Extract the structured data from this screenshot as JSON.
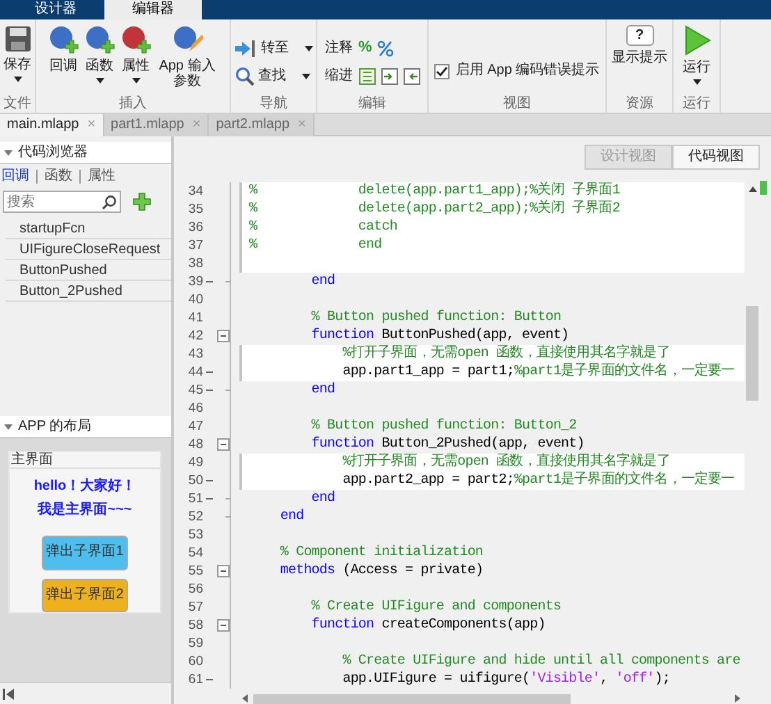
{
  "top_tabs": [
    {
      "label": "设计器",
      "selected": false
    },
    {
      "label": "编辑器",
      "selected": true
    }
  ],
  "ribbon_groups": [
    {
      "label": "文件",
      "items": [
        {
          "kind": "big",
          "label": "保存",
          "dropdown": true
        }
      ]
    },
    {
      "label": "插入",
      "items": [
        {
          "kind": "big",
          "label": "回调",
          "dropdown": false
        },
        {
          "kind": "big",
          "label": "函数",
          "dropdown": true
        },
        {
          "kind": "big",
          "label": "属性",
          "dropdown": true
        },
        {
          "kind": "big",
          "label": "App 输入参数",
          "dropdown": false
        }
      ]
    },
    {
      "label": "导航",
      "items": [
        {
          "kind": "small",
          "label": "转至",
          "dropdown": true
        },
        {
          "kind": "small",
          "label": "查找",
          "dropdown": true
        }
      ]
    },
    {
      "label": "编辑",
      "items": [
        {
          "kind": "tool",
          "label": "注释",
          "symbol": "%"
        },
        {
          "kind": "tool",
          "label": "缩进"
        }
      ]
    },
    {
      "label": "视图",
      "items": [
        {
          "kind": "check",
          "label": "启用 App 编码错误提示",
          "checked": true
        }
      ]
    },
    {
      "label": "资源",
      "items": [
        {
          "kind": "big",
          "label": "显示提示",
          "dropdown": false,
          "symbol": "?"
        }
      ]
    },
    {
      "label": "运行",
      "items": [
        {
          "kind": "big",
          "label": "运行",
          "dropdown": true
        }
      ]
    }
  ],
  "file_tabs": [
    {
      "label": "main.mlapp",
      "close": "×",
      "selected": true
    },
    {
      "label": "part1.mlapp",
      "close": "×",
      "selected": false
    },
    {
      "label": "part2.mlapp",
      "close": "×",
      "selected": false
    }
  ],
  "code_browser": {
    "title": "代码浏览器",
    "expanded": true,
    "tabs": [
      {
        "label": "回调",
        "selected": true
      },
      {
        "label": "函数",
        "selected": false
      },
      {
        "label": "属性",
        "selected": false
      }
    ],
    "search": {
      "placeholder": "搜索"
    },
    "items": [
      "startupFcn",
      "UIFigureCloseRequest",
      "ButtonPushed",
      "Button_2Pushed"
    ]
  },
  "layout_panel": {
    "title": "APP 的布局",
    "expanded": true,
    "window_title": "主界面",
    "labels": [
      "hello！大家好！",
      "我是主界面~~~"
    ],
    "buttons": [
      {
        "label": "弹出子界面1",
        "color": "#4dbeee"
      },
      {
        "label": "弹出子界面2",
        "color": "#edb120"
      }
    ]
  },
  "view_toggle": [
    {
      "label": "设计视图",
      "selected": false
    },
    {
      "label": "代码视图",
      "selected": true
    }
  ],
  "code": {
    "lines": [
      {
        "number": "34",
        "executable": false,
        "fold": false,
        "fold_end": false,
        "editable": true,
        "tokens": [
          {
            "kind": "comment",
            "text": "%             delete(app.part1_app);%关闭 子界面1"
          }
        ]
      },
      {
        "number": "35",
        "executable": false,
        "fold": false,
        "fold_end": false,
        "editable": true,
        "tokens": [
          {
            "kind": "comment",
            "text": "%             delete(app.part2_app);%关闭 子界面2"
          }
        ]
      },
      {
        "number": "36",
        "executable": false,
        "fold": false,
        "fold_end": false,
        "editable": true,
        "tokens": [
          {
            "kind": "comment",
            "text": "%             catch"
          }
        ]
      },
      {
        "number": "37",
        "executable": false,
        "fold": false,
        "fold_end": false,
        "editable": true,
        "tokens": [
          {
            "kind": "comment",
            "text": "%             end"
          }
        ]
      },
      {
        "number": "38",
        "executable": false,
        "fold": false,
        "fold_end": false,
        "editable": true
      },
      {
        "number": "39",
        "executable": true,
        "fold": false,
        "fold_end": true,
        "editable": false,
        "tokens": [
          {
            "kind": "keyword",
            "text": "        end"
          }
        ]
      },
      {
        "number": "40",
        "executable": false,
        "fold": false,
        "fold_end": false,
        "editable": false
      },
      {
        "number": "41",
        "executable": false,
        "fold": false,
        "fold_end": false,
        "editable": false,
        "tokens": [
          {
            "kind": "comment",
            "text": "        % Button pushed function: Button"
          }
        ]
      },
      {
        "number": "42",
        "executable": false,
        "fold": true,
        "fold_end": false,
        "editable": false,
        "tokens": [
          {
            "kind": "keyword",
            "text": "        function"
          },
          {
            "kind": "plain",
            "text": " ButtonPushed(app, event)"
          }
        ]
      },
      {
        "number": "43",
        "executable": false,
        "fold": false,
        "fold_end": false,
        "editable": true,
        "tokens": [
          {
            "kind": "comment",
            "text": "            %打开子界面，无需open 函数，直接使用其名字就是了"
          }
        ]
      },
      {
        "number": "44",
        "executable": true,
        "fold": false,
        "fold_end": false,
        "editable": true,
        "tokens": [
          {
            "kind": "plain",
            "text": "            app.part1_app = part1;"
          },
          {
            "kind": "comment",
            "text": "%part1是子界面的文件名，一定要一"
          }
        ]
      },
      {
        "number": "45",
        "executable": true,
        "fold": false,
        "fold_end": true,
        "editable": false,
        "tokens": [
          {
            "kind": "keyword",
            "text": "        end"
          }
        ]
      },
      {
        "number": "46",
        "executable": false,
        "fold": false,
        "fold_end": false,
        "editable": false
      },
      {
        "number": "47",
        "executable": false,
        "fold": false,
        "fold_end": false,
        "editable": false,
        "tokens": [
          {
            "kind": "comment",
            "text": "        % Button pushed function: Button_2"
          }
        ]
      },
      {
        "number": "48",
        "executable": false,
        "fold": true,
        "fold_end": false,
        "editable": false,
        "tokens": [
          {
            "kind": "keyword",
            "text": "        function"
          },
          {
            "kind": "plain",
            "text": " Button_2Pushed(app, event)"
          }
        ]
      },
      {
        "number": "49",
        "executable": false,
        "fold": false,
        "fold_end": false,
        "editable": true,
        "tokens": [
          {
            "kind": "comment",
            "text": "            %打开子界面，无需open 函数，直接使用其名字就是了"
          }
        ]
      },
      {
        "number": "50",
        "executable": true,
        "fold": false,
        "fold_end": false,
        "editable": true,
        "tokens": [
          {
            "kind": "plain",
            "text": "            app.part2_app = part2;"
          },
          {
            "kind": "comment",
            "text": "%part1是子界面的文件名，一定要一"
          }
        ]
      },
      {
        "number": "51",
        "executable": true,
        "fold": false,
        "fold_end": true,
        "editable": false,
        "tokens": [
          {
            "kind": "keyword",
            "text": "        end"
          }
        ]
      },
      {
        "number": "52",
        "executable": false,
        "fold": false,
        "fold_end": true,
        "editable": false,
        "tokens": [
          {
            "kind": "keyword",
            "text": "    end"
          }
        ]
      },
      {
        "number": "53",
        "executable": false,
        "fold": false,
        "fold_end": false,
        "editable": false
      },
      {
        "number": "54",
        "executable": false,
        "fold": false,
        "fold_end": false,
        "editable": false,
        "tokens": [
          {
            "kind": "comment",
            "text": "    % Component initialization"
          }
        ]
      },
      {
        "number": "55",
        "executable": false,
        "fold": true,
        "fold_end": false,
        "editable": false,
        "tokens": [
          {
            "kind": "keyword",
            "text": "    methods"
          },
          {
            "kind": "plain",
            "text": " (Access = private)"
          }
        ]
      },
      {
        "number": "56",
        "executable": false,
        "fold": false,
        "fold_end": false,
        "editable": false
      },
      {
        "number": "57",
        "executable": false,
        "fold": false,
        "fold_end": false,
        "editable": false,
        "tokens": [
          {
            "kind": "comment",
            "text": "        % Create UIFigure and components"
          }
        ]
      },
      {
        "number": "58",
        "executable": false,
        "fold": true,
        "fold_end": false,
        "editable": false,
        "tokens": [
          {
            "kind": "keyword",
            "text": "        function"
          },
          {
            "kind": "plain",
            "text": " createComponents(app)"
          }
        ]
      },
      {
        "number": "59",
        "executable": false,
        "fold": false,
        "fold_end": false,
        "editable": false
      },
      {
        "number": "60",
        "executable": false,
        "fold": false,
        "fold_end": false,
        "editable": false,
        "tokens": [
          {
            "kind": "comment",
            "text": "            % Create UIFigure and hide until all components are"
          }
        ]
      },
      {
        "number": "61",
        "executable": true,
        "fold": false,
        "fold_end": false,
        "editable": false,
        "tokens": [
          {
            "kind": "plain",
            "text": "            app.UIFigure = uifigure("
          },
          {
            "kind": "string",
            "text": "'Visible'"
          },
          {
            "kind": "plain",
            "text": ", "
          },
          {
            "kind": "string",
            "text": "'off'"
          },
          {
            "kind": "plain",
            "text": ");"
          }
        ]
      }
    ]
  }
}
